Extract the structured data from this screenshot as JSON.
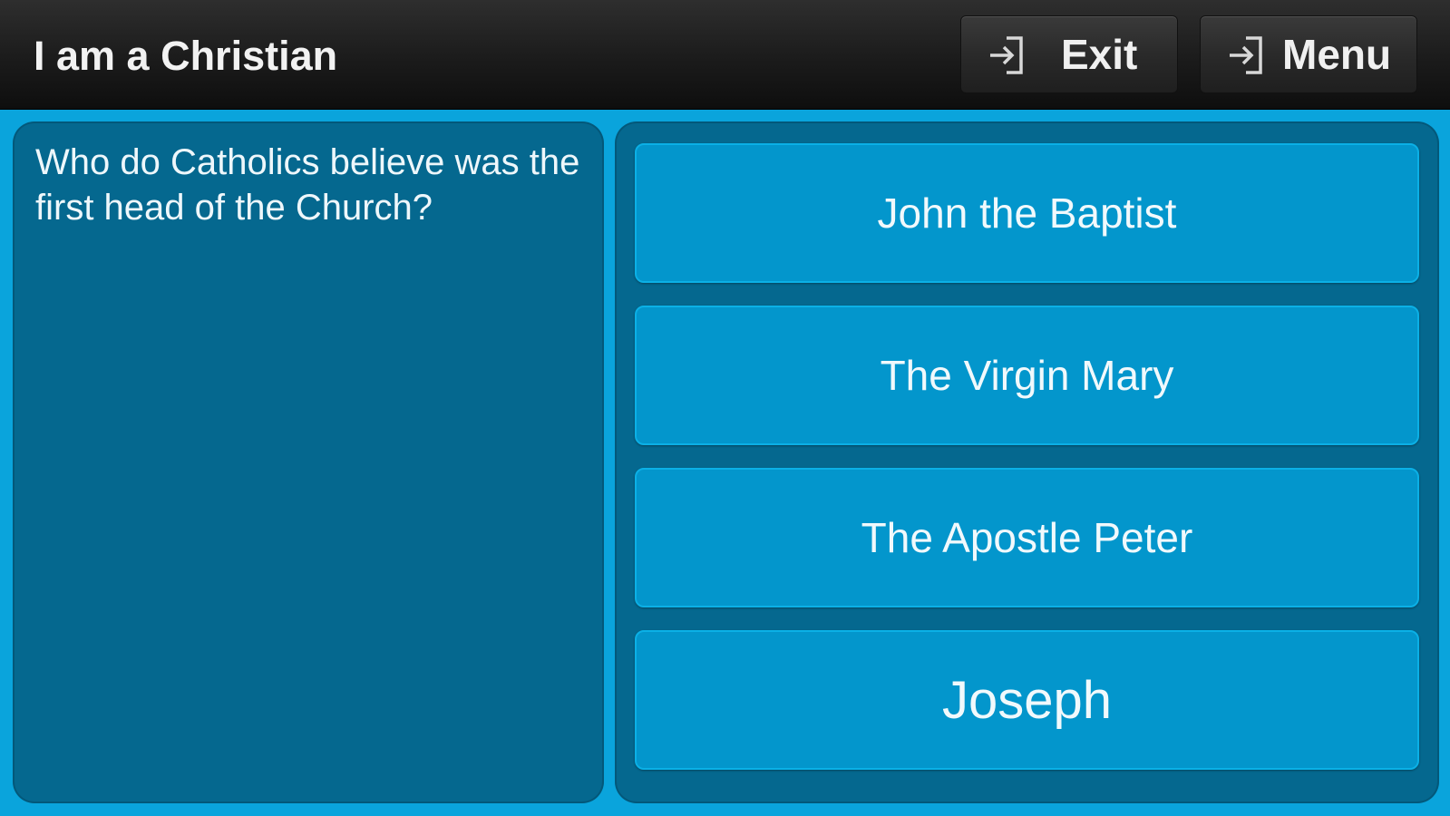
{
  "header": {
    "title": "I am a Christian",
    "exit_label": "Exit",
    "menu_label": "Menu"
  },
  "question": {
    "text": "Who do Catholics believe was the first head of the Church?"
  },
  "answers": [
    {
      "label": "John the Baptist"
    },
    {
      "label": "The Virgin Mary"
    },
    {
      "label": "The Apostle Peter"
    },
    {
      "label": "Joseph"
    }
  ],
  "icons": {
    "exit": "enter-arrow-icon",
    "menu": "enter-arrow-icon"
  },
  "colors": {
    "background": "#0aa4dc",
    "panel": "#05688f",
    "answer_button": "#0396cc",
    "topbar": "#1b1b1b",
    "text": "#ffffff"
  }
}
